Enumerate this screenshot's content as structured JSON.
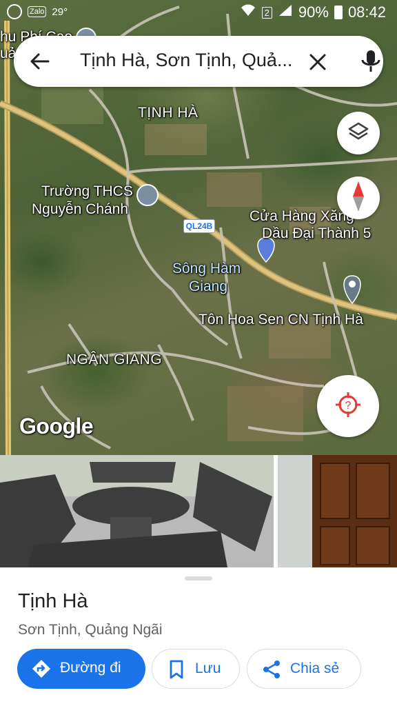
{
  "status_bar": {
    "left_badge": "Zalo",
    "temperature": "29°",
    "sim_slot": "2",
    "battery": "90%",
    "time": "08:42"
  },
  "search": {
    "query": "Tịnh Hà, Sơn Tịnh, Quả...",
    "icons": [
      "back-arrow-icon",
      "close-icon",
      "microphone-icon"
    ]
  },
  "map": {
    "labels": {
      "top_left_partial_1": "hu Phí Cao",
      "top_left_partial_2": "uả",
      "tinh_ha": "TỊNH HÀ",
      "school_line1": "Trường THCS",
      "school_line2": "Nguyễn Chánh",
      "road_shield": "QL24B",
      "gas_line1": "Cửa Hàng Xăng",
      "gas_line2": "Dầu Đại Thành 5",
      "river_line1": "Sông Hàm",
      "river_line2": "Giang",
      "ton_hoa_sen": "Tôn Hoa Sen CN Tịnh Hà",
      "ngan_giang": "NGÂN GIANG",
      "google": "Google"
    },
    "colors": {
      "road": "#c9b98f",
      "pin_blue": "#5b7ddb",
      "pin_gray": "#6b7a89",
      "compass_red": "#e53935"
    }
  },
  "place": {
    "name": "Tịnh Hà",
    "region": "Sơn Tịnh, Quảng Ngãi"
  },
  "actions": {
    "directions": "Đường đi",
    "save": "Lưu",
    "share": "Chia sẻ"
  },
  "theme": {
    "accent": "#1a73e8",
    "text_primary": "#202124",
    "text_secondary": "#5f6368"
  }
}
